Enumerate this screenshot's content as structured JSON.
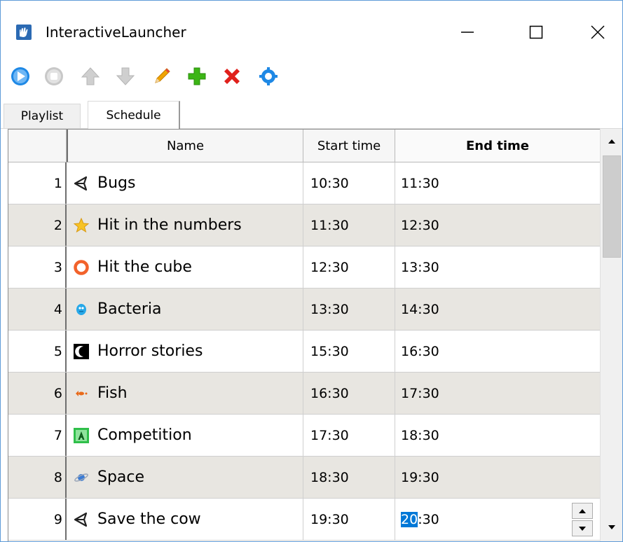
{
  "window": {
    "title": "InteractiveLauncher",
    "controls": [
      "minimize-icon",
      "maximize-icon",
      "close-icon"
    ]
  },
  "toolbar": {
    "buttons": [
      {
        "name": "play-icon",
        "color": "#1e88e5"
      },
      {
        "name": "stop-icon",
        "color": "#c8c8c8"
      },
      {
        "name": "move-up-icon",
        "color": "#c8c8c8"
      },
      {
        "name": "move-down-icon",
        "color": "#c8c8c8"
      },
      {
        "name": "edit-pencil-icon",
        "color": "#f0a400"
      },
      {
        "name": "add-plus-icon",
        "color": "#3cb515"
      },
      {
        "name": "delete-x-icon",
        "color": "#e0201b"
      },
      {
        "name": "settings-gear-icon",
        "color": "#1e88e5"
      }
    ]
  },
  "tabs": [
    {
      "label": "Playlist",
      "active": false
    },
    {
      "label": "Schedule",
      "active": true
    }
  ],
  "table": {
    "columns": [
      "Name",
      "Start time",
      "End time"
    ],
    "sorted_column": "End time",
    "rows": [
      {
        "num": "1",
        "icon": "unity-logo-icon",
        "name": "Bugs",
        "start": "10:30",
        "end": "11:30"
      },
      {
        "num": "2",
        "icon": "star-icon",
        "name": "Hit in the numbers",
        "start": "11:30",
        "end": "12:30"
      },
      {
        "num": "3",
        "icon": "ring-icon",
        "name": "Hit the cube",
        "start": "12:30",
        "end": "13:30"
      },
      {
        "num": "4",
        "icon": "bacteria-icon",
        "name": "Bacteria",
        "start": "13:30",
        "end": "14:30"
      },
      {
        "num": "5",
        "icon": "moon-icon",
        "name": "Horror stories",
        "start": "15:30",
        "end": "16:30"
      },
      {
        "num": "6",
        "icon": "fish-icon",
        "name": "Fish",
        "start": "16:30",
        "end": "17:30"
      },
      {
        "num": "7",
        "icon": "letter-a-icon",
        "name": "Competition",
        "start": "17:30",
        "end": "18:30"
      },
      {
        "num": "8",
        "icon": "planet-icon",
        "name": "Space",
        "start": "18:30",
        "end": "19:30"
      },
      {
        "num": "9",
        "icon": "unity-logo-icon",
        "name": "Save the cow",
        "start": "19:30",
        "end_selected": "20",
        "end_rest": ":30",
        "editing": true
      }
    ]
  },
  "colors": {
    "row_alt": "#e8e6e1",
    "selection": "#0078d7",
    "window_border": "#5f9bd8"
  }
}
